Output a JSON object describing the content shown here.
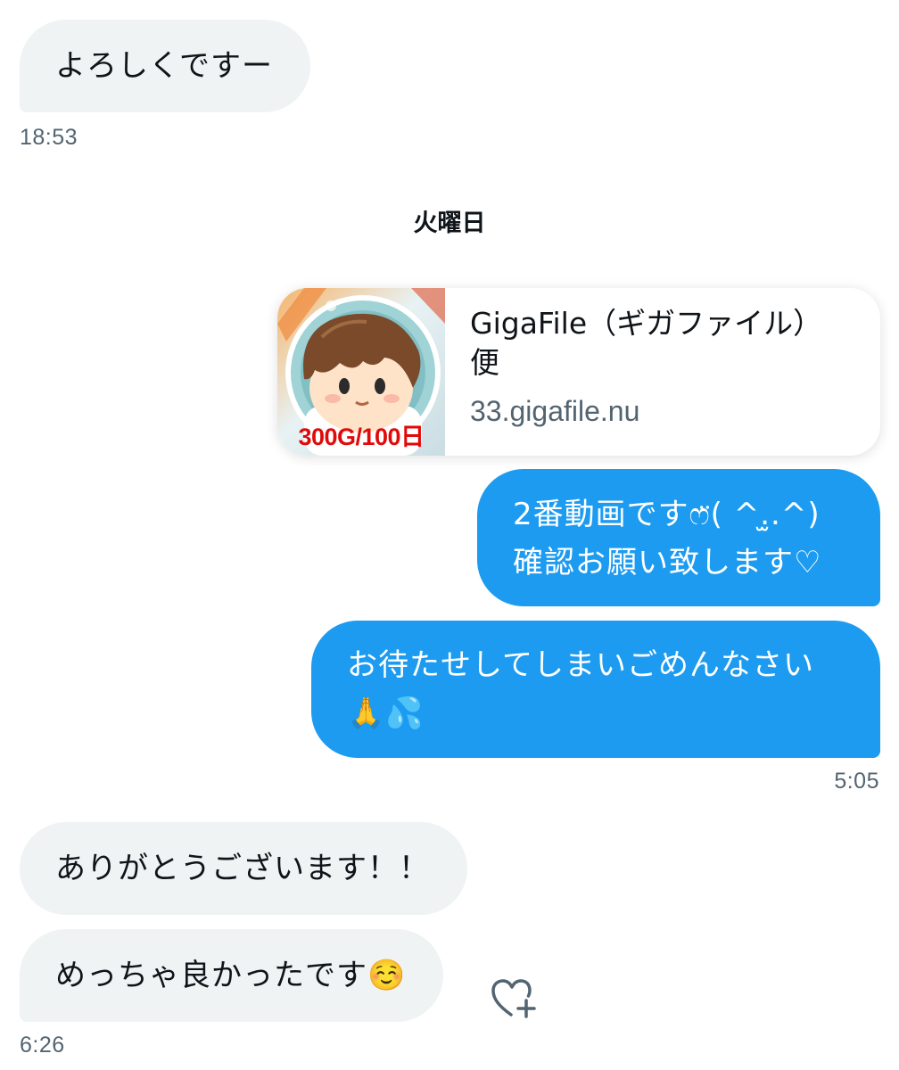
{
  "messages": [
    {
      "text": "よろしくですー",
      "time": "18:53"
    },
    {
      "text": "2番動画ですෆ̈( ^.̫.^)\n確認お願い致します♡"
    },
    {
      "text": "お待たせしてしまいごめんなさい\n🙏💦",
      "time": "5:05"
    },
    {
      "text": "ありがとうございます！！"
    },
    {
      "text": "めっちゃ良かったです☺️",
      "time": "6:26"
    }
  ],
  "day_separator": "火曜日",
  "link_card": {
    "title_line1": "GigaFile（ギガファイル）",
    "title_line2": "便",
    "domain": "33.gigafile.nu",
    "thumb_label": "300G/100日"
  },
  "lines": {
    "m1": "2番動画ですෆ̈( ^.̫.^)",
    "m2": "確認お願い致します♡",
    "m3": "お待たせしてしまいごめんなさい",
    "m4": "🙏💦"
  },
  "icons": {
    "reaction": "heart-plus-icon",
    "thumbnail": "gigafile-astronaut-thumbnail"
  },
  "colors": {
    "outgoing_bubble": "#1d9bf0",
    "incoming_bubble": "#eff3f4",
    "timestamp": "#536471",
    "thumb_label": "#e10a0a"
  }
}
